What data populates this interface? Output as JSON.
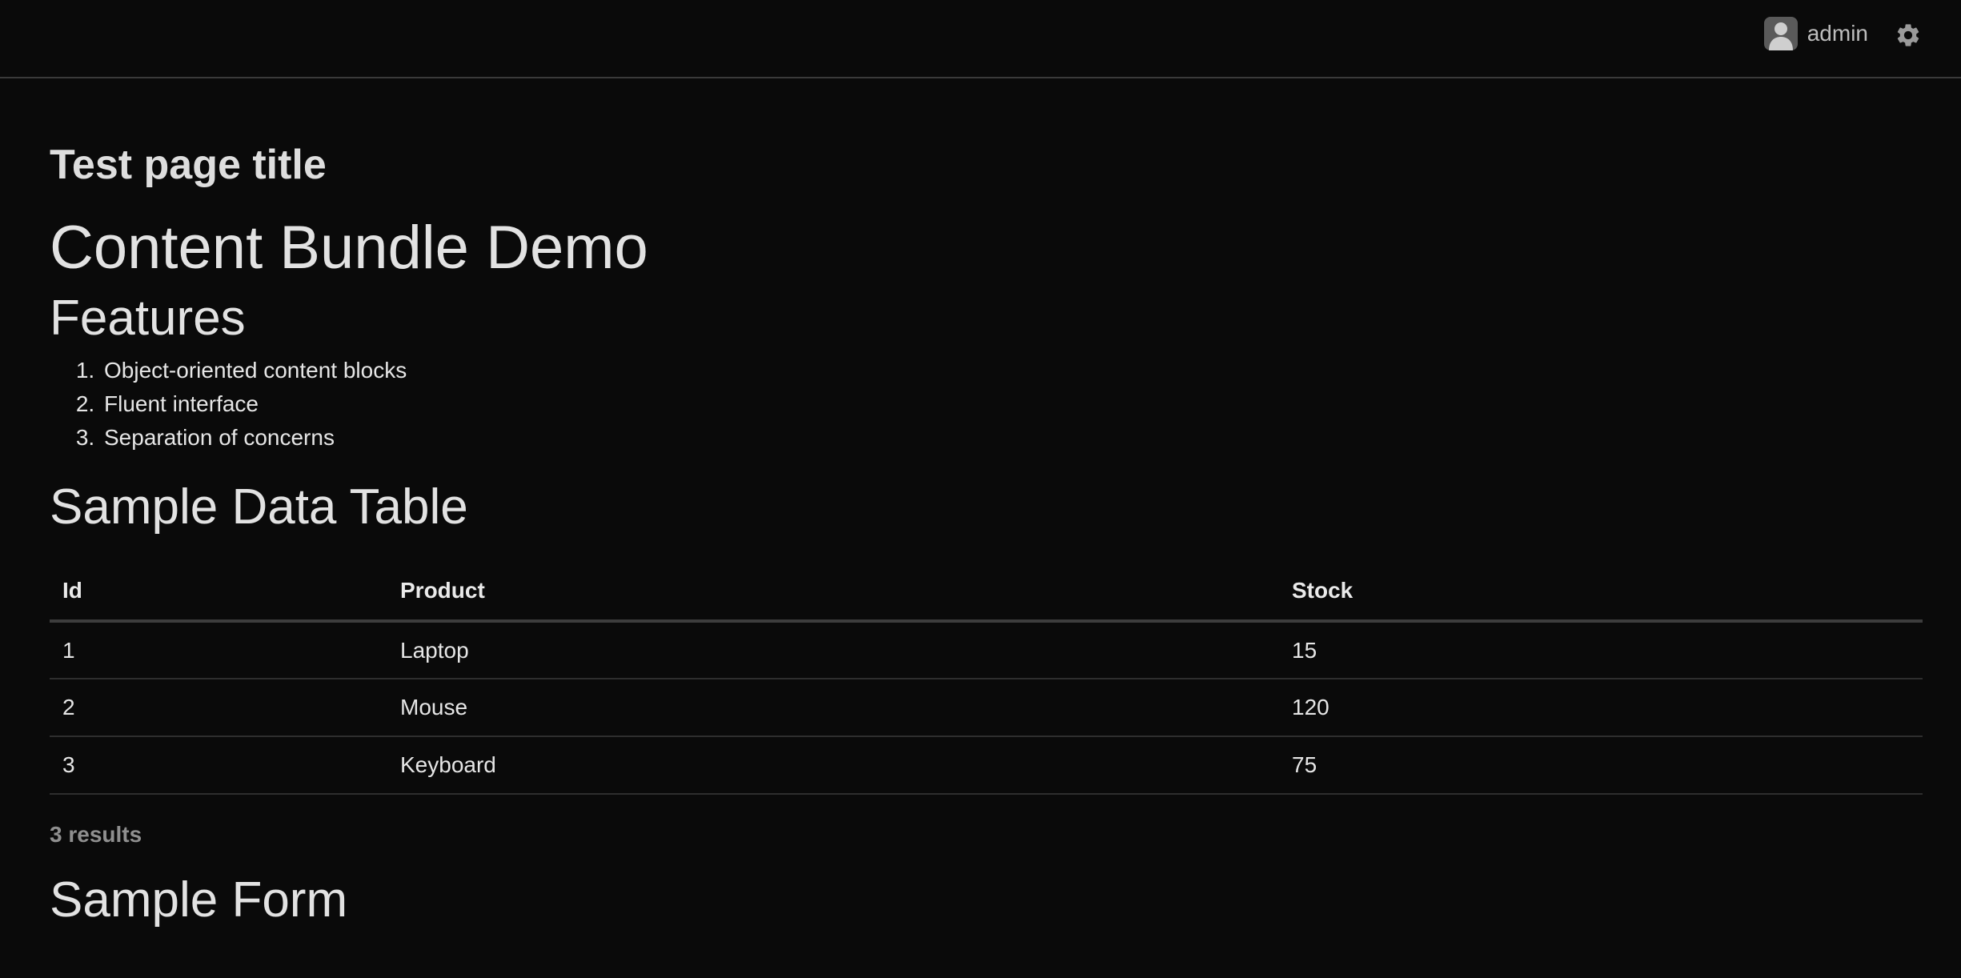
{
  "header": {
    "username": "admin",
    "icons": {
      "avatar": "user-avatar-icon",
      "settings": "gear-icon"
    }
  },
  "page_title": "Test page title",
  "main_heading": "Content Bundle Demo",
  "features": {
    "heading": "Features",
    "items": [
      "Object-oriented content blocks",
      "Fluent interface",
      "Separation of concerns"
    ]
  },
  "table": {
    "heading": "Sample Data Table",
    "columns": [
      "Id",
      "Product",
      "Stock"
    ],
    "rows": [
      [
        "1",
        "Laptop",
        "15"
      ],
      [
        "2",
        "Mouse",
        "120"
      ],
      [
        "3",
        "Keyboard",
        "75"
      ]
    ],
    "result_count": "3 results"
  },
  "form": {
    "heading": "Sample Form"
  }
}
